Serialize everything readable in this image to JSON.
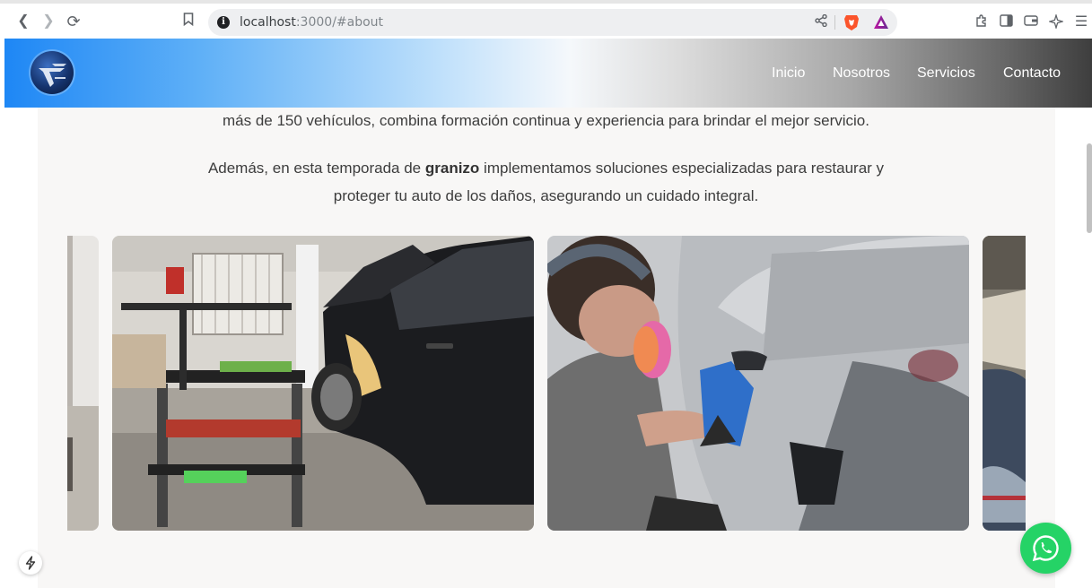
{
  "browser": {
    "url_host": "localhost",
    "url_rest": ":3000/#about",
    "icons": [
      "back-icon",
      "forward-icon",
      "reload-icon",
      "bookmark-icon",
      "site-info-icon",
      "share-icon",
      "brave-shields-icon",
      "brave-rewards-icon",
      "extensions-icon",
      "sidebar-icon",
      "wallet-icon",
      "leo-icon",
      "menu-icon"
    ]
  },
  "header": {
    "logo_icon": "shield-bolt-logo",
    "nav": [
      "Inicio",
      "Nosotros",
      "Servicios",
      "Contacto"
    ]
  },
  "about": {
    "line1": "más de 150 vehículos, combina formación continua y experiencia para brindar el mejor servicio.",
    "line2_before": "Además, en esta temporada de ",
    "line2_bold": "granizo",
    "line2_after": " implementamos soluciones especializadas para restaurar y",
    "line3": "proteger tu auto de los daños, asegurando un cuidado integral."
  },
  "gallery": {
    "photos": [
      "workshop-left-partial",
      "workshop-tool-cart-car",
      "technician-polishing-car",
      "workshop-right-partial"
    ]
  },
  "floating": {
    "whatsapp_icon": "whatsapp-icon",
    "dev_icon": "bolt-icon"
  },
  "colors": {
    "accent": "#1e87f5",
    "whatsapp": "#25d366"
  }
}
